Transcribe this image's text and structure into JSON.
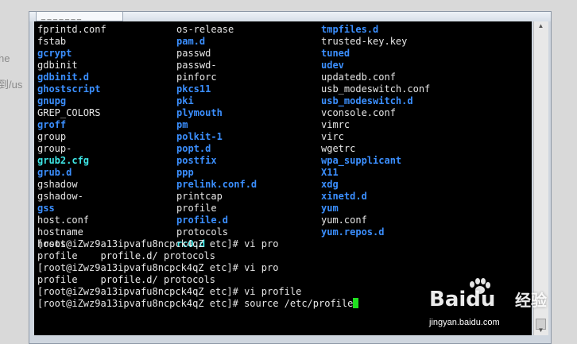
{
  "background": {
    "partial_text_1": "he",
    "partial_text_2": "到/us"
  },
  "window": {
    "tab_label": "_ _ _ _ _ _ _"
  },
  "terminal": {
    "listing": [
      [
        "fprintd.conf",
        "file"
      ],
      [
        "os-release",
        "file"
      ],
      [
        "tmpfiles.d",
        "dir"
      ],
      [
        "fstab",
        "file"
      ],
      [
        "pam.d",
        "dir"
      ],
      [
        "trusted-key.key",
        "file"
      ],
      [
        "gcrypt",
        "dir"
      ],
      [
        "passwd",
        "file"
      ],
      [
        "tuned",
        "dir"
      ],
      [
        "gdbinit",
        "file"
      ],
      [
        "passwd-",
        "file"
      ],
      [
        "udev",
        "dir"
      ],
      [
        "gdbinit.d",
        "dir"
      ],
      [
        "pinforc",
        "file"
      ],
      [
        "updatedb.conf",
        "file"
      ],
      [
        "ghostscript",
        "dir"
      ],
      [
        "pkcs11",
        "dir"
      ],
      [
        "usb_modeswitch.conf",
        "file"
      ],
      [
        "gnupg",
        "dir"
      ],
      [
        "pki",
        "dir"
      ],
      [
        "usb_modeswitch.d",
        "dir"
      ],
      [
        "GREP_COLORS",
        "file"
      ],
      [
        "plymouth",
        "dir"
      ],
      [
        "vconsole.conf",
        "file"
      ],
      [
        "groff",
        "dir"
      ],
      [
        "pm",
        "dir"
      ],
      [
        "vimrc",
        "file"
      ],
      [
        "group",
        "file"
      ],
      [
        "polkit-1",
        "dir"
      ],
      [
        "virc",
        "file"
      ],
      [
        "group-",
        "file"
      ],
      [
        "popt.d",
        "dir"
      ],
      [
        "wgetrc",
        "file"
      ],
      [
        "grub2.cfg",
        "link"
      ],
      [
        "postfix",
        "dir"
      ],
      [
        "wpa_supplicant",
        "dir"
      ],
      [
        "grub.d",
        "dir"
      ],
      [
        "ppp",
        "dir"
      ],
      [
        "X11",
        "dir"
      ],
      [
        "gshadow",
        "file"
      ],
      [
        "prelink.conf.d",
        "dir"
      ],
      [
        "xdg",
        "dir"
      ],
      [
        "gshadow-",
        "file"
      ],
      [
        "printcap",
        "file"
      ],
      [
        "xinetd.d",
        "dir"
      ],
      [
        "gss",
        "dir"
      ],
      [
        "profile",
        "file"
      ],
      [
        "yum",
        "dir"
      ],
      [
        "host.conf",
        "file"
      ],
      [
        "profile.d",
        "dir"
      ],
      [
        "yum.conf",
        "file"
      ],
      [
        "hostname",
        "file"
      ],
      [
        "protocols",
        "file"
      ],
      [
        "yum.repos.d",
        "dir"
      ],
      [
        "hosts",
        "file"
      ],
      [
        "rc0.d",
        "link"
      ],
      [
        "",
        ""
      ]
    ],
    "lines": [
      "[root@iZwz9a13ipvafu8ncpck4qZ etc]# vi pro",
      "profile    profile.d/ protocols",
      "[root@iZwz9a13ipvafu8ncpck4qZ etc]# vi pro",
      "profile    profile.d/ protocols",
      "[root@iZwz9a13ipvafu8ncpck4qZ etc]# vi profile",
      "[root@iZwz9a13ipvafu8ncpck4qZ etc]# source /etc/profile"
    ],
    "colors": {
      "dir": "#3b8fff",
      "link": "#3ee6e6",
      "file": "#e6e6e6",
      "cursor": "#20e020"
    }
  },
  "watermark": {
    "logo": "Bai",
    "logo2": "du",
    "cn": "经验",
    "url": "jingyan.baidu.com"
  }
}
